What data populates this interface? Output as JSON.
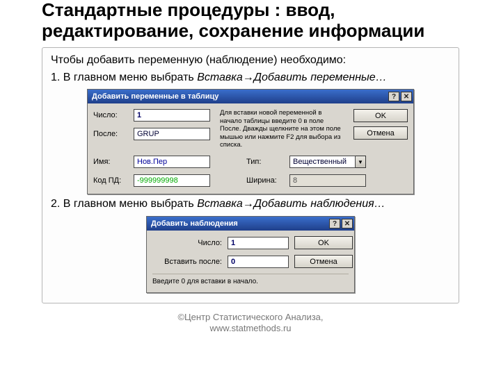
{
  "title": "Стандартные процедуры : ввод, редактирование, сохранение информации",
  "intro": "Чтобы добавить переменную (наблюдение) необходимо:",
  "step1_prefix": "1.  В главном меню выбрать ",
  "step1_menu": "Вставка",
  "step1_arrow": "→",
  "step1_item": "Добавить переменные…",
  "step2_prefix": "2.  В главном меню выбрать ",
  "step2_menu": "Вставка",
  "step2_arrow": "→",
  "step2_item": "Добавить наблюдения…",
  "dlg1": {
    "title": "Добавить переменные в таблицу",
    "help_glyph": "?",
    "close_glyph": "✕",
    "labels": {
      "count": "Число:",
      "after": "После:",
      "name": "Имя:",
      "code": "Код ПД:",
      "type": "Тип:",
      "width": "Ширина:"
    },
    "values": {
      "count": "1",
      "after": "GRUP",
      "name": "Нов.Пер",
      "code": "-999999998",
      "type": "Вещественный",
      "width": "8"
    },
    "hint": "Для вставки новой переменной в начало таблицы введите 0 в поле После. Дважды щелкните на этом поле мышью или нажмите F2 для выбора из списка.",
    "ok": "OK",
    "cancel": "Отмена",
    "drop_glyph": "▼"
  },
  "dlg2": {
    "title": "Добавить наблюдения",
    "help_glyph": "?",
    "close_glyph": "✕",
    "labels": {
      "count": "Число:",
      "after": "Вставить после:"
    },
    "values": {
      "count": "1",
      "after": "0"
    },
    "hint": "Введите 0 для вставки в начало.",
    "ok": "OK",
    "cancel": "Отмена"
  },
  "footer1": "©Центр Статистического Анализа,",
  "footer2": "www.statmethods.ru"
}
